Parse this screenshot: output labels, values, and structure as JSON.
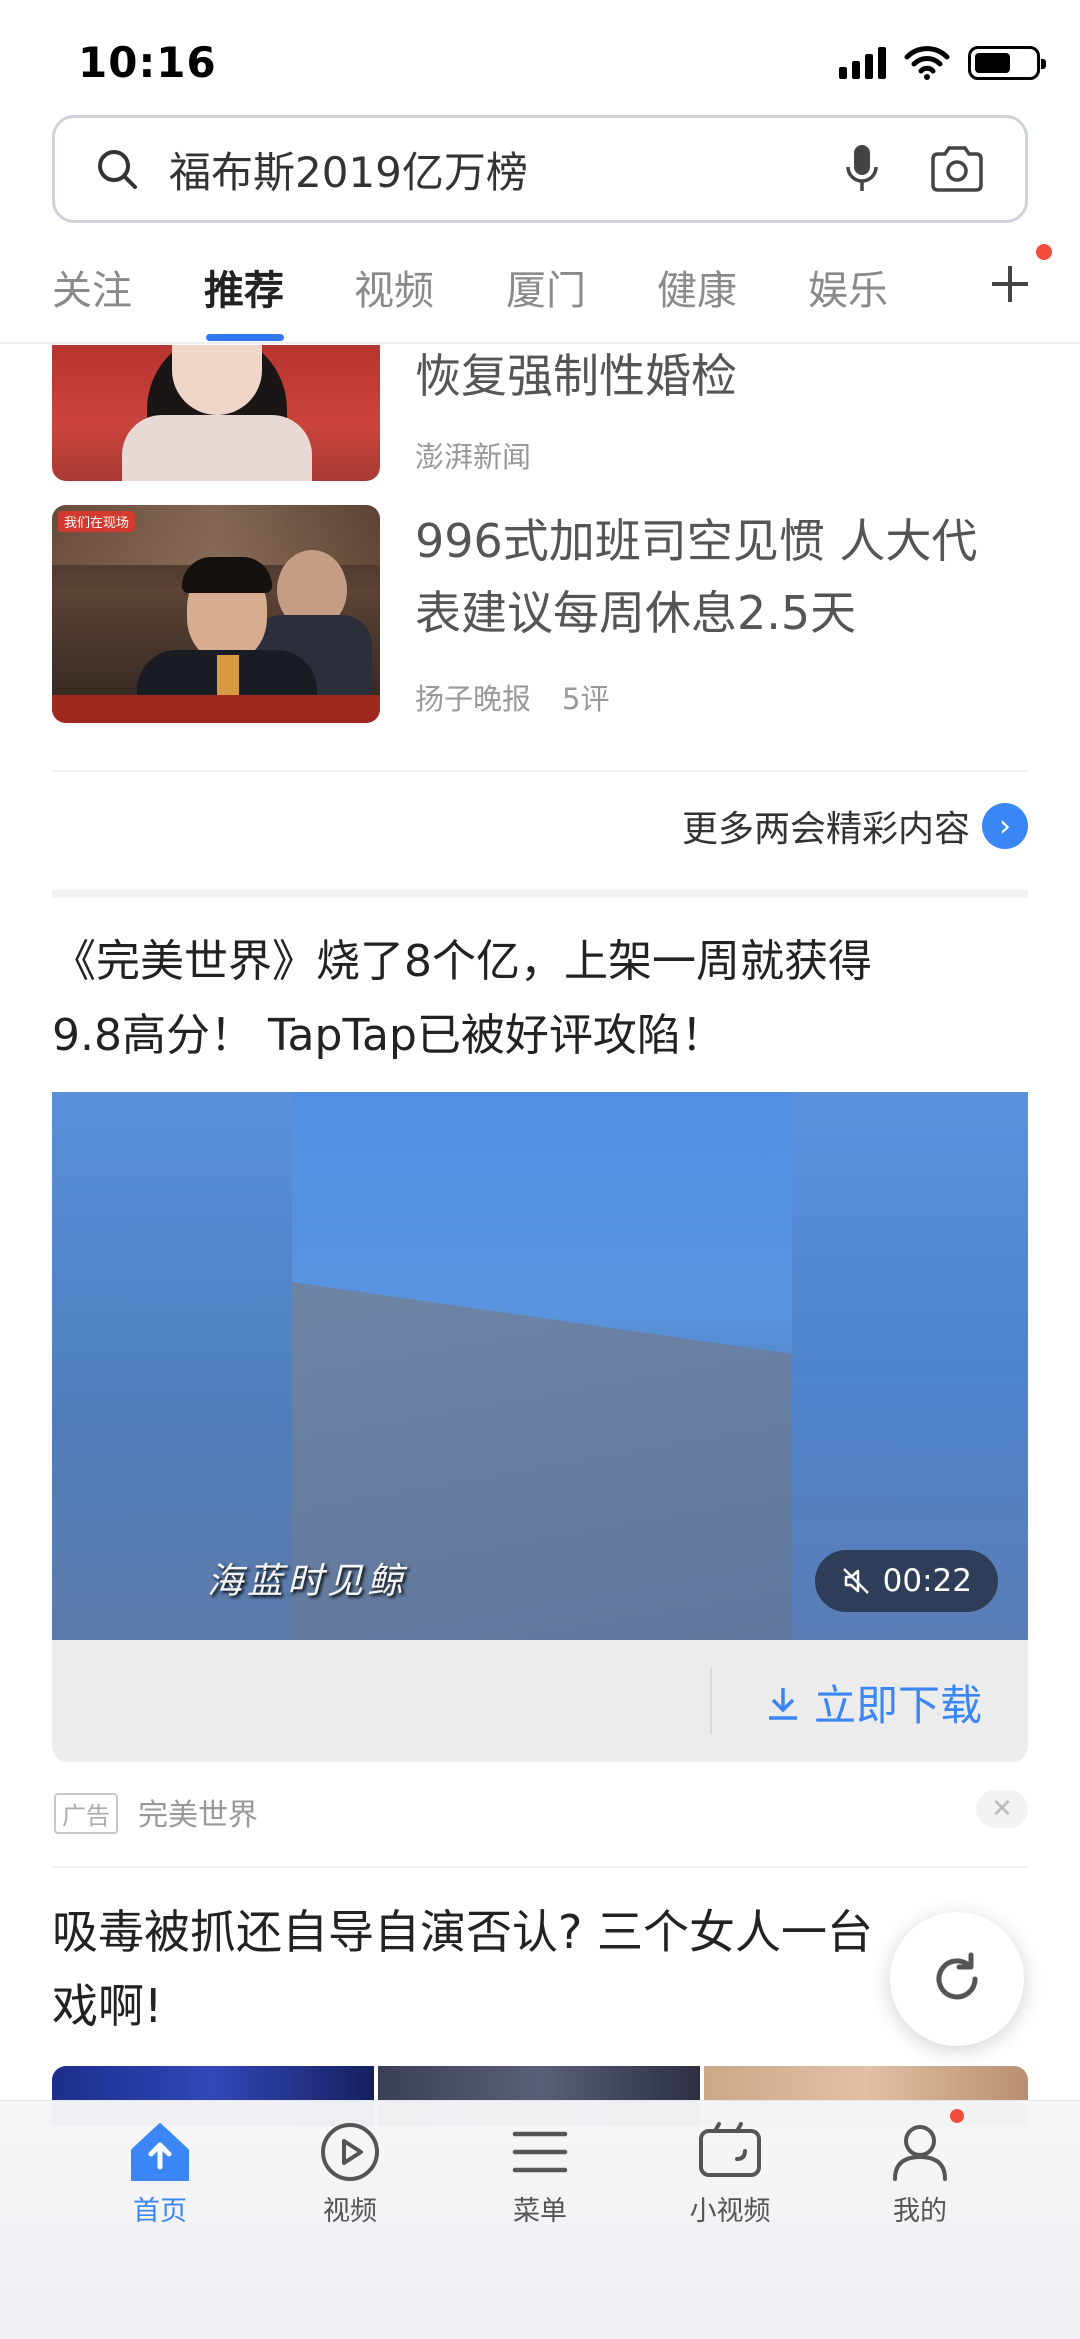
{
  "status_bar": {
    "time": "10:16"
  },
  "search": {
    "query": "福布斯2019亿万榜"
  },
  "tabs": [
    {
      "label": "关注"
    },
    {
      "label": "推荐",
      "active": true
    },
    {
      "label": "视频"
    },
    {
      "label": "厦门"
    },
    {
      "label": "健康"
    },
    {
      "label": "娱乐"
    }
  ],
  "feed": {
    "item1": {
      "title": "恢复强制性婚检",
      "source": "澎湃新闻"
    },
    "item2": {
      "title_line1": "996式加班司空见惯 人大代",
      "title_line2": "表建议每周休息2.5天",
      "source": "扬子晚报",
      "comments": "5评",
      "thumb_badge": "我们在现场"
    },
    "more": {
      "label": "更多两会精彩内容"
    },
    "ad": {
      "title_line1": "《完美世界》烧了8个亿，上架一周就获得",
      "title_line2": "9.8高分！ TapTap已被好评攻陷！",
      "video_subtitle": "海蓝时见鲸",
      "duration": "00:22",
      "download_label": "立即下载",
      "badge": "广告",
      "source": "完美世界",
      "close": "✕"
    },
    "item3": {
      "title_line1": "吸毒被抓还自导自演否认? 三个女人一台",
      "title_line2": "戏啊!"
    }
  },
  "bottom_nav": [
    {
      "label": "首页",
      "icon": "home-icon",
      "active": true
    },
    {
      "label": "视频",
      "icon": "play-circle-icon"
    },
    {
      "label": "菜单",
      "icon": "menu-icon"
    },
    {
      "label": "小视频",
      "icon": "video-camera-icon"
    },
    {
      "label": "我的",
      "icon": "person-icon"
    }
  ],
  "colors": {
    "accent": "#3a86f4",
    "notification": "#f24c3d"
  }
}
